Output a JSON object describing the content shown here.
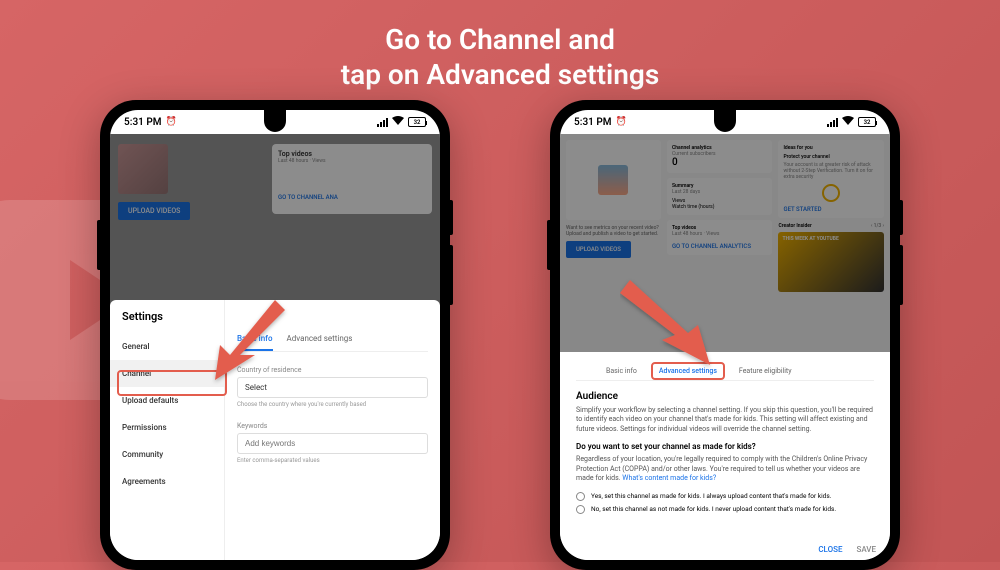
{
  "headline": {
    "line1": "Go to Channel and",
    "line2": "tap on Advanced settings"
  },
  "status": {
    "time": "5:31 PM",
    "battery": "32"
  },
  "phone1": {
    "dim": {
      "upload_btn": "UPLOAD VIDEOS",
      "top_videos": "Top videos",
      "top_sub": "Last 48 hours · Views",
      "channel_link": "GO TO CHANNEL ANA"
    },
    "settings_title": "Settings",
    "sidebar": {
      "items": [
        {
          "label": "General"
        },
        {
          "label": "Channel"
        },
        {
          "label": "Upload defaults"
        },
        {
          "label": "Permissions"
        },
        {
          "label": "Community"
        },
        {
          "label": "Agreements"
        }
      ]
    },
    "tabs": {
      "basic": "Basic info",
      "advanced": "Advanced settings"
    },
    "country": {
      "label": "Country of residence",
      "value": "Select",
      "helper": "Choose the country where you're currently based"
    },
    "keywords": {
      "label": "Keywords",
      "placeholder": "Add keywords",
      "helper": "Enter comma-separated values"
    }
  },
  "phone2": {
    "dim": {
      "analytics_title": "Channel analytics",
      "subs_label": "Current subscribers",
      "subs_value": "0",
      "summary": "Summary",
      "summary_sub": "Last 28 days",
      "views": "Views",
      "watch": "Watch time (hours)",
      "top_videos": "Top videos",
      "top_sub": "Last 48 hours · Views",
      "link": "GO TO CHANNEL ANALYTICS",
      "upload": "UPLOAD VIDEOS",
      "ideas": "Ideas for you",
      "protect": "Protect your channel",
      "protect_body": "Your account is at greater risk of attack without 2-Step Verification. Turn it on for extra security",
      "get_started": "GET STARTED",
      "creator": "Creator Insider",
      "thumb_text": "THIS WEEK AT YOUTUBE"
    },
    "tabs": {
      "basic": "Basic info",
      "advanced": "Advanced settings",
      "feature": "Feature eligibility"
    },
    "audience": {
      "title": "Audience",
      "body": "Simplify your workflow by selecting a channel setting. If you skip this question, you'll be required to identify each video on your channel that's made for kids. This setting will affect existing and future videos. Settings for individual videos will override the channel setting.",
      "question": "Do you want to set your channel as made for kids?",
      "legal": "Regardless of your location, you're legally required to comply with the Children's Online Privacy Protection Act (COPPA) and/or other laws. You're required to tell us whether your videos are made for kids.",
      "link": "What's content made for kids?",
      "opt1": "Yes, set this channel as made for kids. I always upload content that's made for kids.",
      "opt2": "No, set this channel as not made for kids. I never upload content that's made for kids."
    },
    "footer": {
      "close": "CLOSE",
      "save": "SAVE"
    }
  }
}
